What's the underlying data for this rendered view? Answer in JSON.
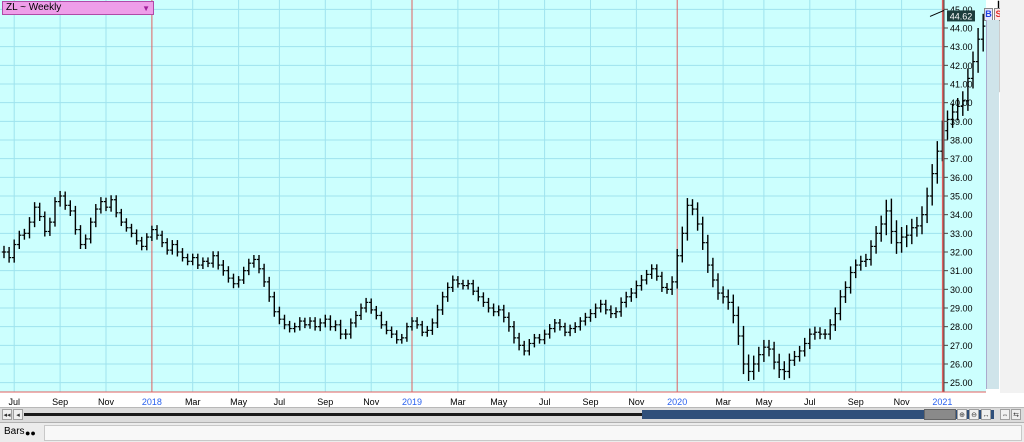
{
  "header": {
    "title": "ZL ~ Weekly",
    "buy_label": "B",
    "sell_label": "S"
  },
  "bottom": {
    "bars_label": "Bars",
    "bars_icon": "●●"
  },
  "colors": {
    "background": "#ccfffe",
    "grid": "#9fe3ee",
    "bar": "#000000",
    "year_line": "#e06060",
    "year_label": "#2a62f0"
  },
  "chart_data": {
    "type": "ohlc",
    "title": "ZL ~ Weekly",
    "last_price": 44.62,
    "ylim": [
      24.5,
      45.5
    ],
    "y_ticks": [
      "25.00",
      "26.00",
      "27.00",
      "28.00",
      "29.00",
      "30.00",
      "31.00",
      "32.00",
      "33.00",
      "34.00",
      "35.00",
      "36.00",
      "37.00",
      "38.00",
      "39.00",
      "40.00",
      "41.00",
      "42.00",
      "43.00",
      "44.00",
      "45.00"
    ],
    "x_ticks": [
      {
        "label": "Jul",
        "week": 2,
        "year": false
      },
      {
        "label": "Sep",
        "week": 11,
        "year": false
      },
      {
        "label": "Nov",
        "week": 20,
        "year": false
      },
      {
        "label": "2018",
        "week": 29,
        "year": true
      },
      {
        "label": "Mar",
        "week": 37,
        "year": false
      },
      {
        "label": "May",
        "week": 46,
        "year": false
      },
      {
        "label": "Jul",
        "week": 54,
        "year": false
      },
      {
        "label": "Sep",
        "week": 63,
        "year": false
      },
      {
        "label": "Nov",
        "week": 72,
        "year": false
      },
      {
        "label": "2019",
        "week": 80,
        "year": true
      },
      {
        "label": "Mar",
        "week": 89,
        "year": false
      },
      {
        "label": "May",
        "week": 97,
        "year": false
      },
      {
        "label": "Jul",
        "week": 106,
        "year": false
      },
      {
        "label": "Sep",
        "week": 115,
        "year": false
      },
      {
        "label": "Nov",
        "week": 124,
        "year": false
      },
      {
        "label": "2020",
        "week": 132,
        "year": true
      },
      {
        "label": "Mar",
        "week": 141,
        "year": false
      },
      {
        "label": "May",
        "week": 149,
        "year": false
      },
      {
        "label": "Jul",
        "week": 158,
        "year": false
      },
      {
        "label": "Sep",
        "week": 167,
        "year": false
      },
      {
        "label": "Nov",
        "week": 176,
        "year": false
      },
      {
        "label": "2021",
        "week": 184,
        "year": true
      }
    ],
    "close": [
      32.0,
      31.7,
      32.4,
      32.9,
      33.0,
      33.6,
      34.4,
      33.9,
      33.1,
      33.6,
      34.7,
      35.0,
      34.5,
      34.2,
      33.2,
      32.4,
      32.7,
      33.6,
      34.3,
      34.7,
      34.4,
      34.8,
      34.1,
      33.6,
      33.3,
      33.0,
      32.6,
      32.3,
      32.8,
      33.2,
      32.9,
      32.5,
      32.1,
      32.4,
      32.0,
      31.7,
      31.5,
      31.7,
      31.3,
      31.5,
      31.4,
      31.8,
      31.3,
      31.0,
      30.6,
      30.3,
      30.5,
      31.0,
      31.4,
      31.6,
      31.1,
      30.4,
      29.6,
      28.8,
      28.4,
      28.1,
      27.9,
      28.0,
      28.3,
      28.1,
      28.3,
      28.0,
      28.2,
      28.4,
      28.0,
      28.1,
      27.6,
      27.6,
      28.2,
      28.6,
      29.0,
      29.3,
      28.9,
      28.6,
      28.1,
      27.8,
      27.6,
      27.3,
      27.4,
      28.0,
      28.3,
      28.1,
      27.7,
      27.8,
      28.2,
      28.9,
      29.6,
      30.1,
      30.5,
      30.3,
      30.2,
      30.3,
      29.9,
      29.6,
      29.3,
      29.0,
      28.8,
      28.9,
      28.5,
      28.0,
      27.4,
      27.0,
      26.7,
      27.1,
      27.4,
      27.3,
      27.6,
      27.9,
      28.2,
      28.0,
      27.7,
      27.9,
      28.0,
      28.3,
      28.5,
      28.7,
      29.0,
      29.2,
      28.9,
      28.7,
      28.8,
      29.3,
      29.6,
      29.8,
      30.2,
      30.5,
      30.8,
      31.1,
      30.7,
      30.1,
      30.0,
      30.4,
      31.8,
      33.0,
      34.5,
      34.3,
      33.5,
      32.5,
      31.3,
      30.5,
      29.8,
      29.6,
      29.3,
      28.6,
      27.5,
      26.0,
      25.6,
      26.0,
      26.5,
      26.9,
      26.8,
      26.1,
      25.7,
      25.6,
      26.2,
      26.4,
      26.7,
      27.1,
      27.6,
      27.7,
      27.6,
      27.6,
      28.1,
      28.7,
      29.6,
      30.1,
      30.9,
      31.3,
      31.5,
      31.6,
      32.3,
      33.0,
      33.5,
      34.2,
      33.1,
      32.5,
      32.8,
      32.9,
      33.3,
      33.4,
      34.0,
      35.0,
      36.2,
      37.4,
      38.5,
      39.1,
      39.5,
      39.8,
      40.1,
      41.3,
      42.2,
      43.4,
      44.1,
      42.0,
      41.4,
      44.62
    ],
    "range": [
      1.1,
      0.9,
      0.9,
      0.8,
      0.8,
      0.9,
      0.9,
      0.8,
      0.9,
      0.8,
      0.8,
      0.9,
      0.8,
      0.9,
      0.9,
      0.8,
      0.8,
      0.8,
      0.9,
      0.8,
      0.7,
      0.8,
      0.8,
      0.7,
      0.7,
      0.7,
      0.7,
      0.7,
      0.7,
      0.7,
      0.8,
      0.8,
      0.8,
      0.8,
      0.8,
      0.7,
      0.7,
      0.7,
      0.7,
      0.7,
      0.7,
      0.8,
      0.8,
      0.9,
      0.8,
      0.8,
      0.7,
      0.7,
      0.8,
      0.8,
      0.8,
      0.9,
      0.9,
      0.9,
      0.9,
      0.8,
      0.7,
      0.7,
      0.7,
      0.6,
      0.7,
      0.7,
      0.8,
      0.8,
      0.7,
      0.8,
      0.9,
      0.9,
      0.8,
      0.8,
      0.8,
      0.8,
      0.7,
      0.7,
      0.7,
      0.7,
      0.7,
      0.7,
      0.7,
      0.7,
      0.7,
      0.7,
      0.7,
      0.8,
      0.8,
      0.9,
      0.9,
      0.9,
      0.8,
      0.7,
      0.7,
      0.7,
      0.7,
      0.8,
      0.8,
      0.8,
      0.8,
      0.8,
      0.9,
      0.9,
      1.0,
      0.9,
      0.8,
      0.8,
      0.7,
      0.7,
      0.8,
      0.8,
      0.7,
      0.7,
      0.7,
      0.7,
      0.8,
      0.7,
      0.8,
      0.8,
      0.8,
      0.8,
      0.8,
      0.8,
      0.8,
      0.9,
      0.9,
      0.9,
      0.9,
      0.9,
      0.8,
      0.8,
      0.8,
      0.8,
      0.8,
      1.0,
      1.2,
      1.2,
      1.3,
      1.1,
      1.2,
      1.3,
      1.4,
      1.3,
      1.2,
      1.2,
      1.3,
      1.4,
      1.6,
      1.8,
      1.7,
      1.5,
      1.4,
      1.3,
      1.3,
      1.3,
      1.5,
      1.5,
      1.2,
      1.0,
      0.9,
      1.0,
      1.0,
      1.0,
      0.9,
      0.9,
      1.0,
      1.1,
      1.2,
      1.1,
      1.1,
      1.0,
      1.0,
      1.0,
      1.1,
      1.3,
      1.5,
      2.0,
      2.2,
      2.0,
      1.8,
      1.8,
      1.6,
      1.6,
      1.5,
      1.5,
      1.7,
      1.8,
      1.8,
      1.6,
      1.5,
      1.5,
      1.7,
      1.8,
      1.8,
      2.0,
      2.2,
      2.8,
      3.0,
      2.8
    ]
  }
}
